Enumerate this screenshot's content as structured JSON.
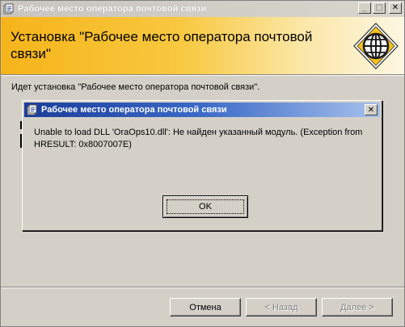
{
  "window": {
    "title": "Рабочее место оператора почтовой связи",
    "minimize_glyph": "_",
    "maximize_glyph": "□",
    "close_glyph": "✕"
  },
  "banner": {
    "title": "Установка \"Рабочее место оператора почтовой связи\""
  },
  "main": {
    "install_text": "Идет установка \"Рабочее место оператора почтовой связи\"."
  },
  "dialog": {
    "title": "Рабочее место оператора почтовой связи",
    "close_glyph": "✕",
    "message": "Unable to load DLL 'OraOps10.dll': Не найден указанный модуль. (Exception from HRESULT: 0x8007007E)",
    "ok_label": "OK"
  },
  "buttons": {
    "cancel_label": "Отмена",
    "back_label": "< Назад",
    "next_label": "Далее >"
  },
  "colors": {
    "banner_accent": "#f6b41a",
    "dialog_title_bar": "#1b3d9a",
    "window_face": "#d4d0c8"
  }
}
